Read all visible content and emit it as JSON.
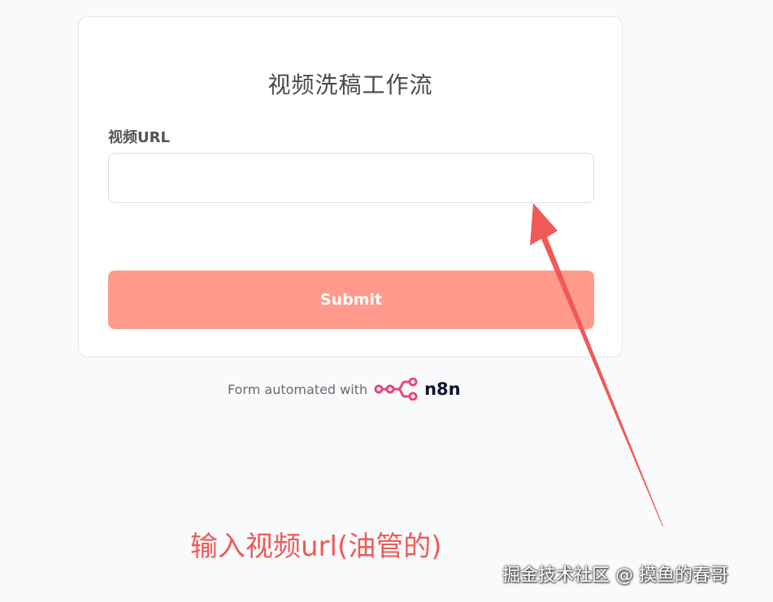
{
  "form": {
    "title": "视频洗稿工作流",
    "field_label": "视频URL",
    "field_value": "",
    "field_placeholder": "",
    "submit_label": "Submit"
  },
  "footer": {
    "text": "Form automated with",
    "brand": "n8n"
  },
  "annotation": {
    "text": "输入视频url(油管的)"
  },
  "watermark": {
    "text": "掘金技术社区 @ 摸鱼的春哥"
  },
  "colors": {
    "page_bg": "#f9fafc",
    "submit_bg": "#ff9a8c",
    "annotation": "#f05a56",
    "n8n_logo": "#e8467c"
  },
  "icons": {
    "n8n_logo": "n8n-logo-icon",
    "arrow": "annotation-arrow"
  }
}
